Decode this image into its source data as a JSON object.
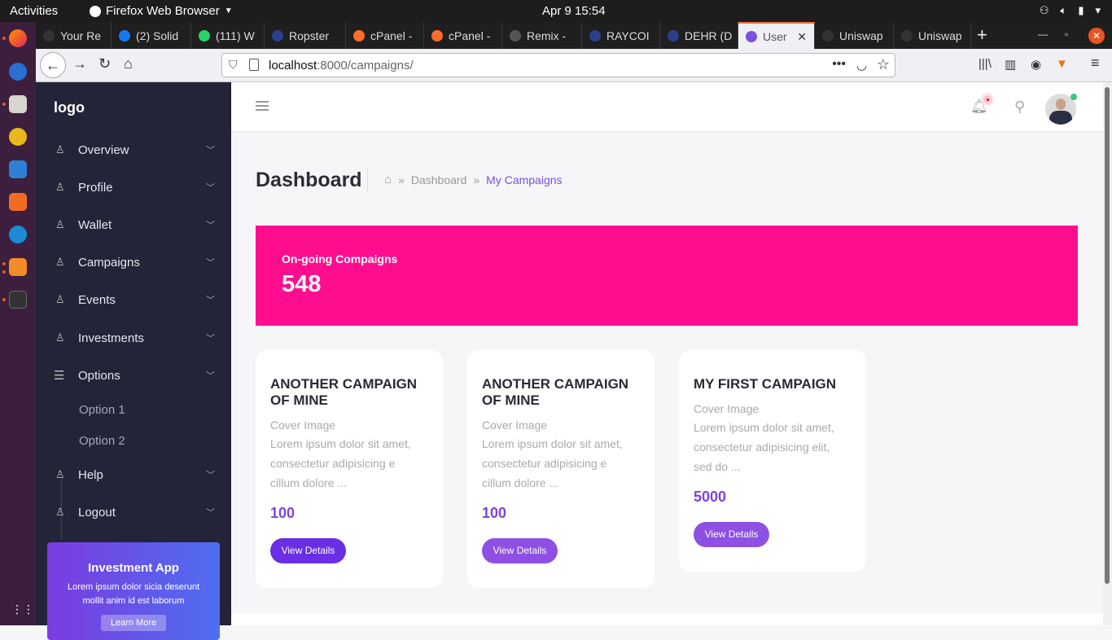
{
  "os": {
    "activities": "Activities",
    "app_menu": "Firefox Web Browser",
    "clock": "Apr 9  15:54",
    "tray_icons": [
      "network-icon",
      "volume-icon",
      "battery-icon",
      "power-menu-icon"
    ]
  },
  "dock": {
    "apps": [
      "firefox-icon",
      "thunderbird-icon",
      "files-icon",
      "rhythmbox-icon",
      "writer-icon",
      "software-icon",
      "help-icon",
      "sublime-icon",
      "terminal-icon",
      "app-grid-icon"
    ]
  },
  "browser": {
    "tabs": [
      {
        "label": "Your Re",
        "color": "#333333"
      },
      {
        "label": "(2) Solid",
        "color": "#1877f2"
      },
      {
        "label": "(111) W",
        "color": "#25d366"
      },
      {
        "label": "Ropster",
        "color": "#2c3e8c"
      },
      {
        "label": "cPanel -",
        "color": "#ff6c2c"
      },
      {
        "label": "cPanel -",
        "color": "#ff6c2c"
      },
      {
        "label": "Remix -",
        "color": "#555555"
      },
      {
        "label": "RAYCOI",
        "color": "#2c3e8c"
      },
      {
        "label": "DEHR (D",
        "color": "#2c3e8c"
      },
      {
        "label": "User",
        "color": "#7b51db"
      },
      {
        "label": "Uniswap",
        "color": "#333333"
      },
      {
        "label": "Uniswap",
        "color": "#333333"
      }
    ],
    "url_host": "localhost",
    "url_path": ":8000/campaigns/"
  },
  "sidebar": {
    "logo": "logo",
    "items": [
      {
        "label": "Overview"
      },
      {
        "label": "Profile"
      },
      {
        "label": "Wallet"
      },
      {
        "label": "Campaigns"
      },
      {
        "label": "Events"
      },
      {
        "label": "Investments"
      },
      {
        "label": "Options"
      },
      {
        "label": "Help"
      },
      {
        "label": "Logout"
      }
    ],
    "sub_items": [
      "Option 1",
      "Option 2"
    ],
    "promo": {
      "title": "Investment App",
      "text": "Lorem ipsum dolor sicia deserunt mollit anim id est laborum",
      "button": "Learn More"
    }
  },
  "page": {
    "title": "Dashboard",
    "breadcrumb": [
      "Dashboard",
      "My Campaigns"
    ],
    "stat": {
      "label": "On-going Compaigns",
      "value": "548",
      "color": "#ff0d8f"
    },
    "cards": [
      {
        "title": "ANOTHER CAMPAIGN OF MINE",
        "subtitle": "Cover Image",
        "desc": "Lorem ipsum dolor sit amet, consectetur adipisicing e cillum dolore ...",
        "amount": "100",
        "button": "View Details"
      },
      {
        "title": "ANOTHER CAMPAIGN OF MINE",
        "subtitle": "Cover Image",
        "desc": "Lorem ipsum dolor sit amet, consectetur adipisicing e cillum dolore ...",
        "amount": "100",
        "button": "View Details"
      },
      {
        "title": "MY FIRST CAMPAIGN",
        "subtitle": "Cover Image",
        "desc": "Lorem ipsum dolor sit amet, consectetur adipisicing elit, sed do ...",
        "amount": "5000",
        "button": "View Details"
      }
    ]
  },
  "colors": {
    "accent": "#7b51db",
    "sidebar_bg": "#242438",
    "button": "#6a2ee5"
  }
}
